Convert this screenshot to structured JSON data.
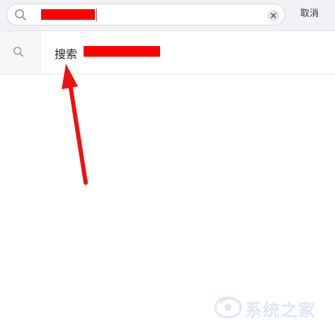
{
  "search": {
    "cancel_label": "取消"
  },
  "suggestion": {
    "prefix": "搜索"
  },
  "watermark": {
    "text": "系统之家"
  },
  "colors": {
    "redaction": "#ff0000",
    "arrow": "#ee1111",
    "top_bar_bg": "#f2f1f6"
  },
  "icons": {
    "search": "search-icon",
    "clear": "close-icon",
    "suggestion": "search-icon"
  }
}
